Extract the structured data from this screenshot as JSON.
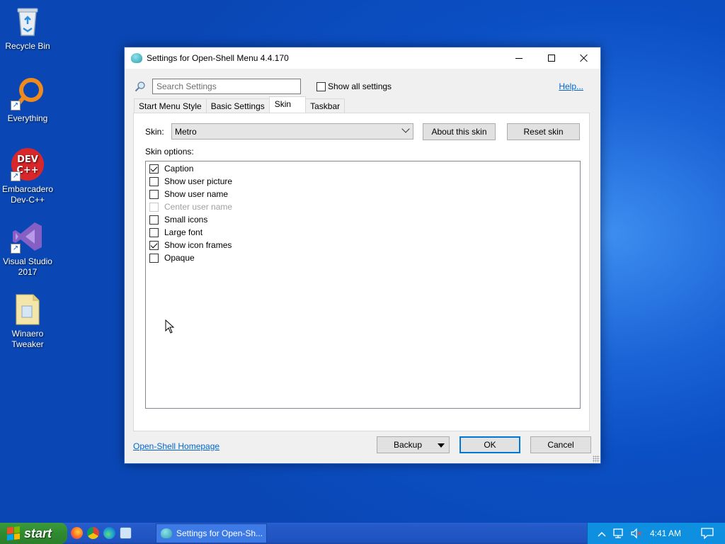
{
  "desktop": {
    "icons": [
      {
        "label": "Recycle Bin"
      },
      {
        "label": "Everything"
      },
      {
        "label": "Embarcadero Dev-C++"
      },
      {
        "label": "Visual Studio 2017"
      },
      {
        "label": "Winaero Tweaker"
      }
    ],
    "devcpp_logo": {
      "line1": "DEV",
      "line2": "C++"
    }
  },
  "window": {
    "title": "Settings for Open-Shell Menu 4.4.170",
    "search_placeholder": "Search Settings",
    "show_all_label": "Show all settings",
    "help_link": "Help...",
    "tabs": [
      {
        "label": "Start Menu Style",
        "active": false
      },
      {
        "label": "Basic Settings",
        "active": false
      },
      {
        "label": "Skin",
        "active": true
      },
      {
        "label": "Taskbar",
        "active": false
      }
    ],
    "skin_label": "Skin:",
    "skin_value": "Metro",
    "about_skin_button": "About this skin",
    "reset_skin_button": "Reset skin",
    "skin_options_label": "Skin options:",
    "options": [
      {
        "label": "Caption",
        "checked": true,
        "disabled": false
      },
      {
        "label": "Show user picture",
        "checked": false,
        "disabled": false
      },
      {
        "label": "Show user name",
        "checked": false,
        "disabled": false
      },
      {
        "label": "Center user name",
        "checked": false,
        "disabled": true
      },
      {
        "label": "Small icons",
        "checked": false,
        "disabled": false
      },
      {
        "label": "Large font",
        "checked": false,
        "disabled": false
      },
      {
        "label": "Show icon frames",
        "checked": true,
        "disabled": false
      },
      {
        "label": "Opaque",
        "checked": false,
        "disabled": false
      }
    ],
    "homepage_link": "Open-Shell Homepage",
    "backup_button": "Backup",
    "ok_button": "OK",
    "cancel_button": "Cancel"
  },
  "taskbar": {
    "start_label": "start",
    "task_button_label": "Settings for Open-Sh...",
    "clock": "4:41 AM"
  },
  "colors": {
    "accent": "#0078d7",
    "link": "#0066cc",
    "start_green": "#2f8a2f",
    "taskbar_blue": "#245ac9"
  }
}
